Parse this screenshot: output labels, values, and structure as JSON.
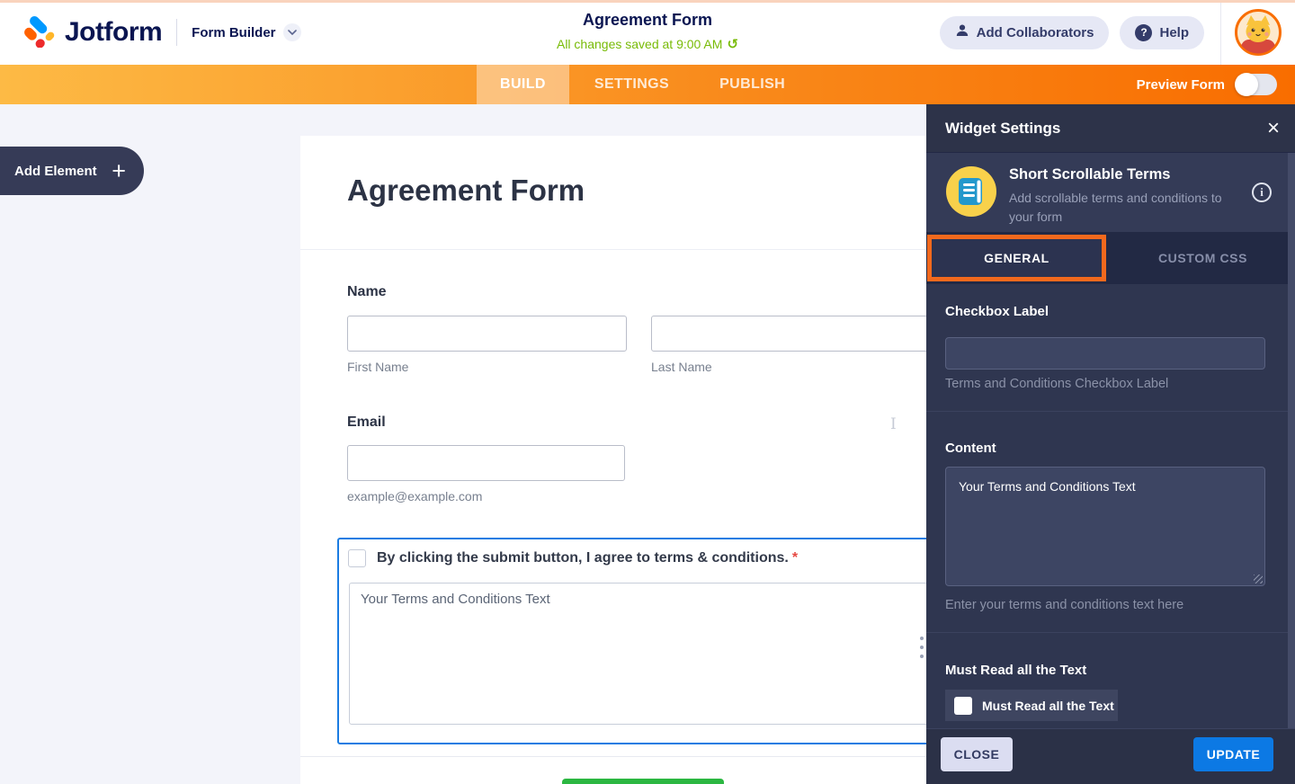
{
  "header": {
    "brand": "Jotform",
    "product": "Form Builder",
    "form_title": "Agreement Form",
    "autosave_status": "All changes saved at 9:00 AM",
    "add_collaborators_label": "Add Collaborators",
    "help_label": "Help"
  },
  "nav": {
    "tabs": [
      {
        "label": "BUILD",
        "active": true
      },
      {
        "label": "SETTINGS",
        "active": false
      },
      {
        "label": "PUBLISH",
        "active": false
      }
    ],
    "preview_label": "Preview Form",
    "preview_on": false
  },
  "canvas": {
    "add_element_label": "Add Element",
    "form_heading": "Agreement Form",
    "name_label": "Name",
    "first_name_sublabel": "First Name",
    "last_name_sublabel": "Last Name",
    "email_label": "Email",
    "email_sublabel": "example@example.com",
    "agreement_checkbox_label": "By clicking the submit button, I agree to terms & conditions.",
    "required_asterisk": "*",
    "terms_box_text": "Your Terms and Conditions Text"
  },
  "panel": {
    "title": "Widget Settings",
    "widget_name": "Short Scrollable Terms",
    "widget_description": "Add scrollable terms and conditions to your form",
    "tabs": [
      {
        "label": "GENERAL",
        "active": true
      },
      {
        "label": "CUSTOM CSS",
        "active": false
      }
    ],
    "checkbox_label_heading": "Checkbox Label",
    "checkbox_label_value": "",
    "checkbox_label_hint": "Terms and Conditions Checkbox Label",
    "content_heading": "Content",
    "content_value": "Your Terms and Conditions Text",
    "content_hint": "Enter your terms and conditions text here",
    "must_read_heading": "Must Read all the Text",
    "must_read_checkbox_label": "Must Read all the Text",
    "must_read_checked": false,
    "close_label": "CLOSE",
    "update_label": "UPDATE"
  },
  "icons": {
    "close": "×",
    "plus": "+",
    "help": "?",
    "undo": "↺",
    "info": "i"
  },
  "colors": {
    "brand_navy": "#0a1551",
    "nav_gradient_start": "#fdba45",
    "nav_gradient_end": "#f96d00",
    "autosave_green": "#78bb07",
    "selection_blue": "#1b7ce2",
    "tab_highlight_orange": "#f2691d",
    "update_blue": "#0c79e4",
    "submit_green": "#2bb741",
    "panel_navy": "#2f3650"
  }
}
